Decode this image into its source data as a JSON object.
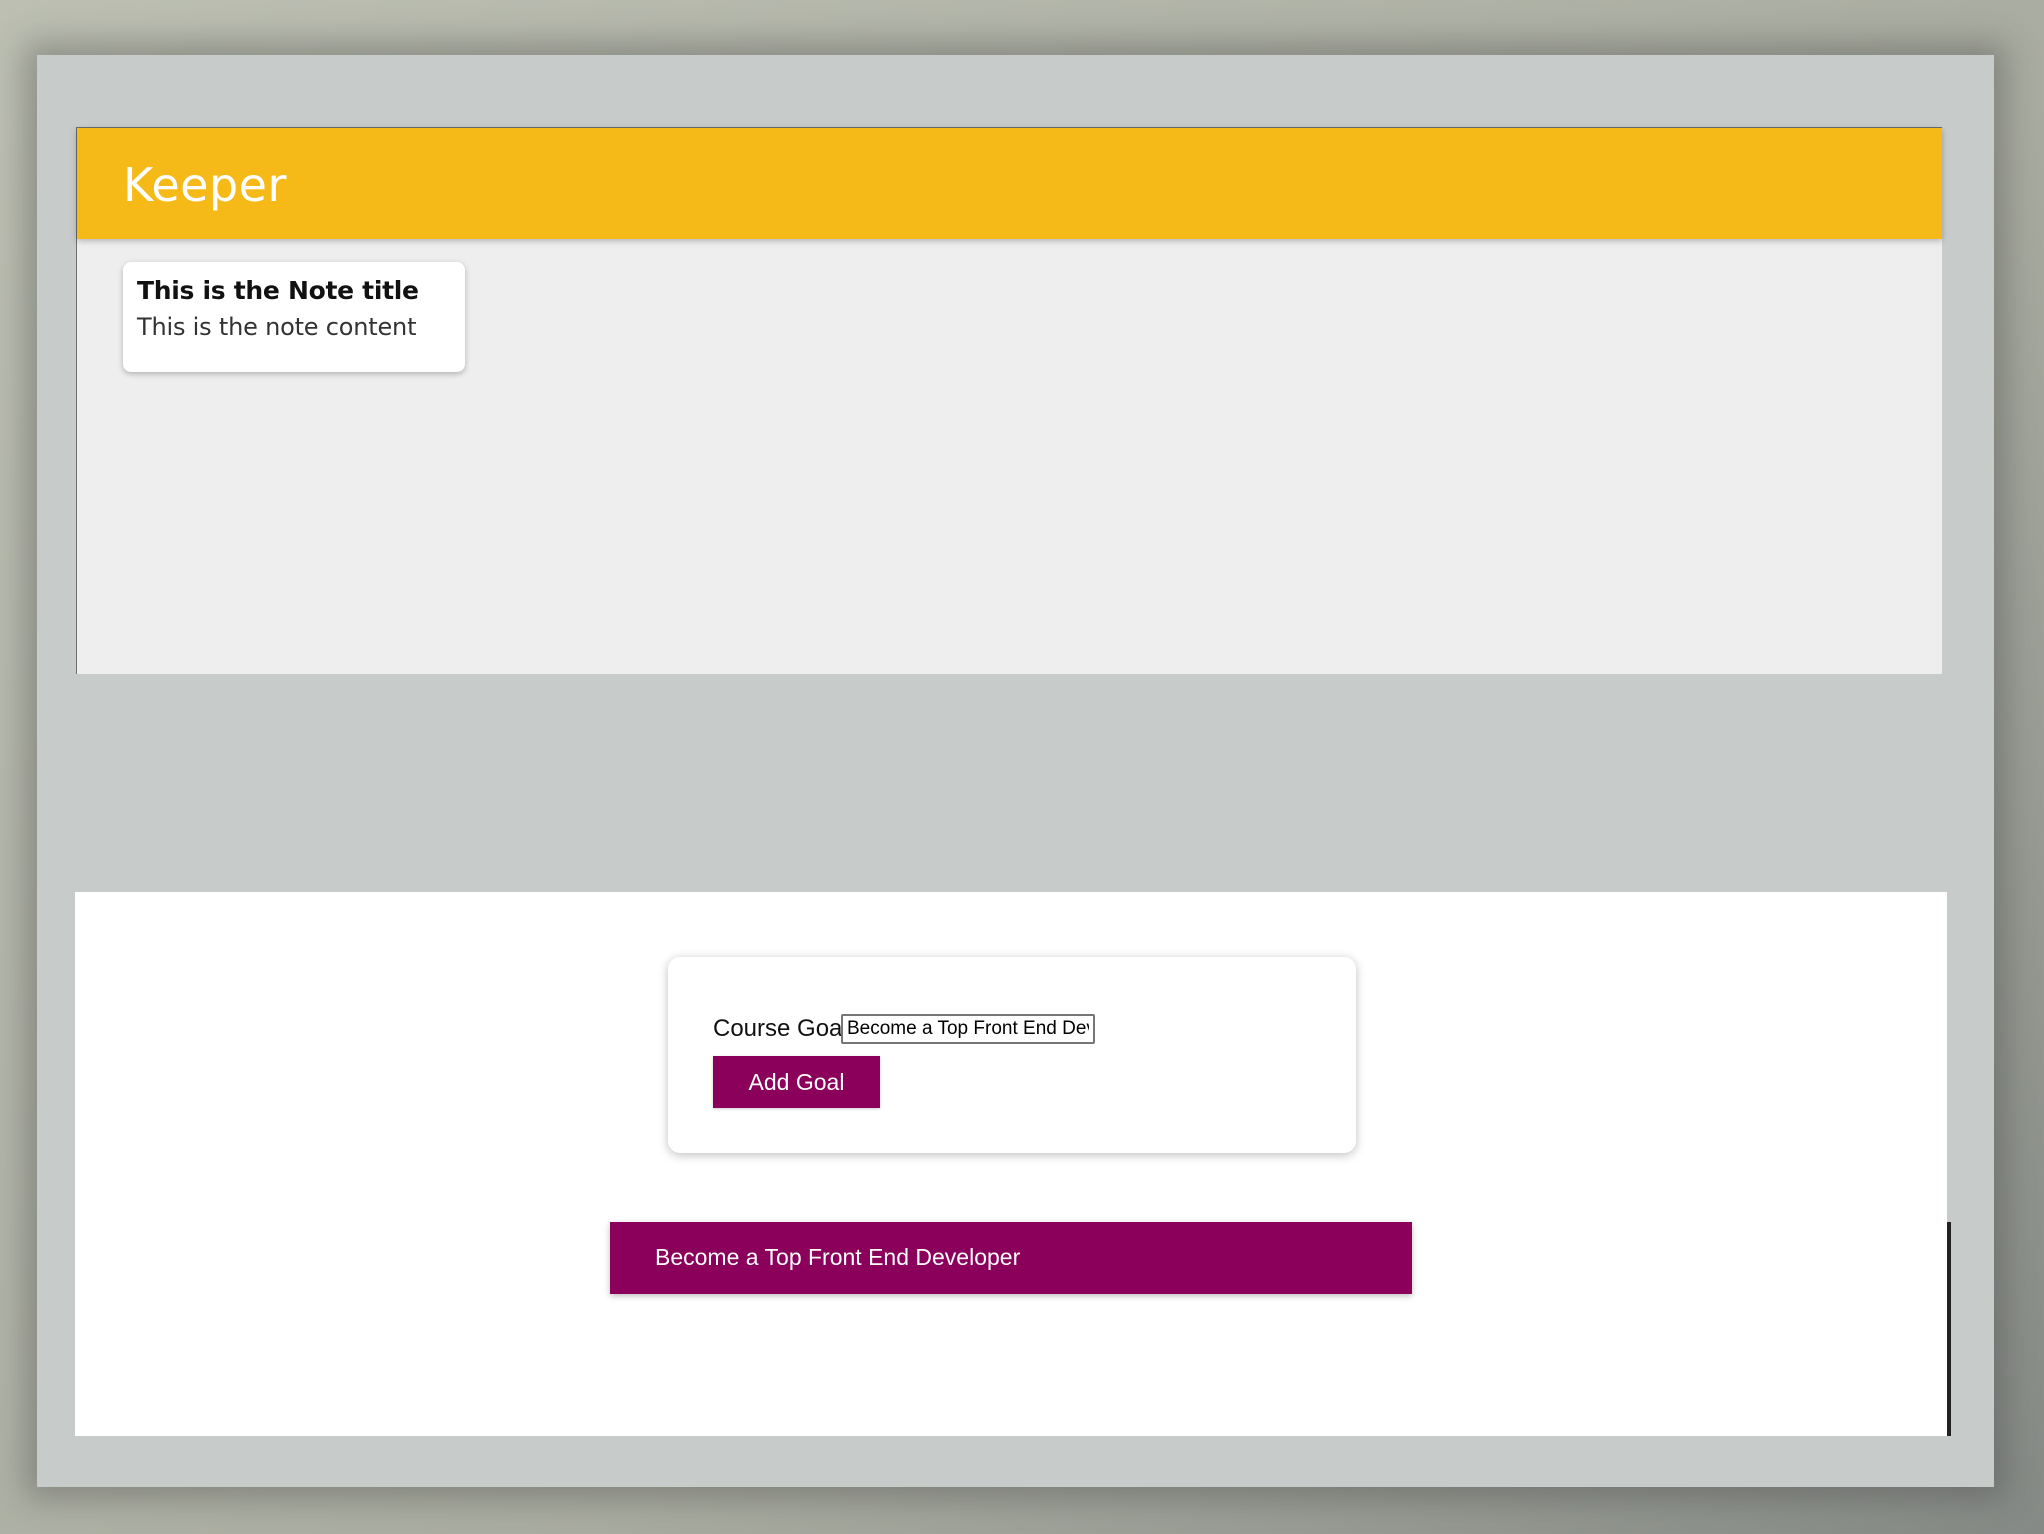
{
  "keeper": {
    "title": "Keeper",
    "notes": [
      {
        "title": "This is the Note title",
        "content": "This is the note content"
      }
    ]
  },
  "course_goals": {
    "form": {
      "label": "Course Goal",
      "input_value": "Become a Top Front End Developer",
      "button_label": "Add Goal"
    },
    "goals": [
      "Become a Top Front End Developer"
    ]
  },
  "colors": {
    "keeper_header": "#f5ba18",
    "keeper_background": "#eeeeee",
    "goals_accent": "#8b005b"
  }
}
